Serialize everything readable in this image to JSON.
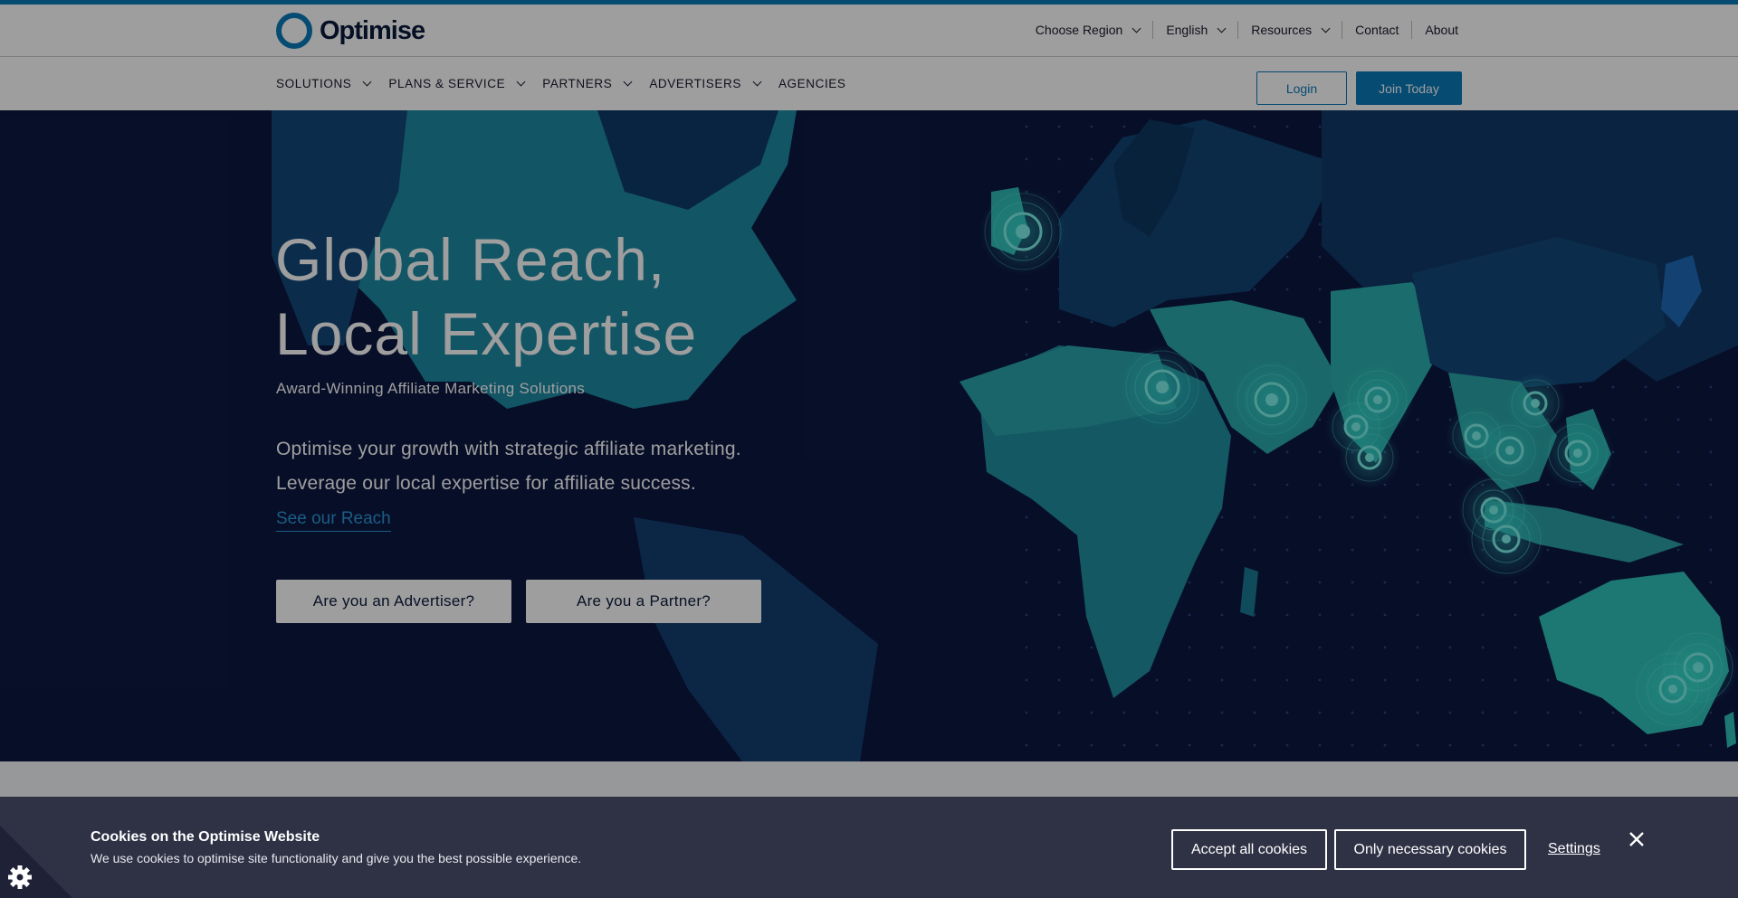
{
  "brand": {
    "name": "Optimise",
    "accent": "#0a7ab8",
    "dark": "#0b1a3a"
  },
  "util_nav": [
    {
      "label": "Choose Region",
      "dropdown": true
    },
    {
      "label": "English",
      "dropdown": true
    },
    {
      "label": "Resources",
      "dropdown": true
    },
    {
      "label": "Contact",
      "dropdown": false
    },
    {
      "label": "About",
      "dropdown": false
    }
  ],
  "main_nav": [
    {
      "label": "SOLUTIONS",
      "dropdown": true
    },
    {
      "label": "PLANS & SERVICE",
      "dropdown": true
    },
    {
      "label": "PARTNERS",
      "dropdown": true
    },
    {
      "label": "ADVERTISERS",
      "dropdown": true
    },
    {
      "label": "AGENCIES",
      "dropdown": false
    }
  ],
  "auth": {
    "login": "Login",
    "join": "Join Today"
  },
  "hero": {
    "title_line1": "Global Reach,",
    "title_line2": "Local Expertise",
    "subtitle": "Award-Winning Affiliate Marketing Solutions",
    "body_line1": "Optimise your growth with strategic affiliate marketing.",
    "body_line2": "Leverage our local expertise for affiliate success.",
    "link": "See our Reach",
    "cta_advertiser": "Are you an Advertiser?",
    "cta_partner": "Are you a Partner?"
  },
  "cookie": {
    "title": "Cookies on the Optimise Website",
    "text": "We use cookies to optimise site functionality and give you the best possible experience.",
    "accept_all": "Accept all cookies",
    "necessary": "Only necessary cookies",
    "settings": "Settings",
    "close_icon": "close-icon",
    "corner_icon": "gear-icon"
  },
  "icons": {
    "chevron": "chevron-down-icon",
    "location": "location-pulse-icon"
  }
}
